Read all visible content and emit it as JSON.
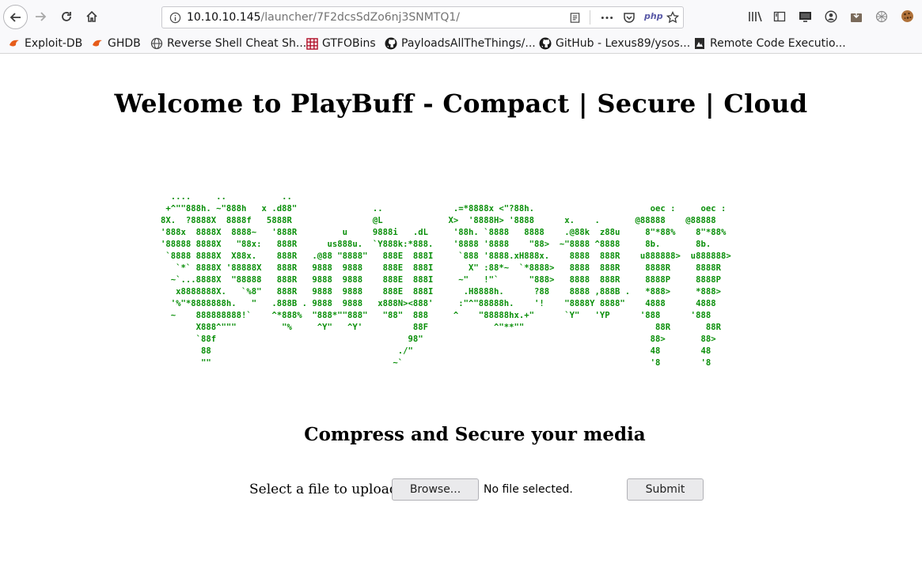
{
  "browser": {
    "url_host": "10.10.10.145",
    "url_path": "/launcher/7F2dcsSdZo6nj3SNMTQ1/",
    "php_label": "php",
    "toolbar_icons": [
      "back-icon",
      "forward-icon",
      "reload-icon",
      "home-icon",
      "info-icon",
      "reader-view-icon",
      "more-icon",
      "pocket-icon",
      "php-icon",
      "star-icon",
      "library-icon",
      "sidebar-icon",
      "screen-icon",
      "account-icon",
      "addon-icon",
      "extension-icon",
      "cookie-icon"
    ],
    "bookmarks": [
      {
        "label": "Exploit-DB",
        "icon": "exploit-db-icon"
      },
      {
        "label": "GHDB",
        "icon": "ghdb-icon"
      },
      {
        "label": "Reverse Shell Cheat Sh...",
        "icon": "globe-icon"
      },
      {
        "label": "GTFOBins",
        "icon": "gtfobins-icon"
      },
      {
        "label": "PayloadsAllTheThings/...",
        "icon": "github-icon"
      },
      {
        "label": "GitHub - Lexus89/ysos...",
        "icon": "github-icon"
      },
      {
        "label": "Remote Code Executio...",
        "icon": "page-icon"
      }
    ]
  },
  "page": {
    "title": "Welcome to PlayBuff - Compact | Secure | Cloud",
    "ascii_art": "  ....     ..           ..               \n +^\"\"888h. ~\"888h   x .d88\"               ..              .=*8888x <\"?88h.                       oec :     oec :\n8X.  ?8888X  8888f   5888R                @L             X>  '8888H> '8888      x.    .       @88888    @88888\n'888x  8888X  8888~   '888R         u     9888i   .dL     '88h. `8888   8888    .@88k  z88u     8\"*88%    8\"*88%\n'88888 8888X   \"88x:   888R      us888u.  `Y888k:*888.    '8888 '8888    \"88>  ~\"8888 ^8888     8b.       8b.\n `8888 8888X  X88x.    888R   .@88 \"8888\"   888E  888I     `888 '8888.xH888x.    8888  888R    u888888>  u888888>\n   `*` 8888X '88888X   888R   9888  9888    888E  888I       X\" :88*~  `*8888>   8888  888R     8888R     8888R\n  ~`...8888X  \"88888   888R   9888  9888    888E  888I     ~\"   !\"`      \"888>   8888  888R     8888P     8888P\n   x8888888X.   `%8\"   888R   9888  9888    888E  888I      .H8888h.      ?88    8888 ,888B .   *888>     *888>\n  '%\"*8888888h.   \"   .888B . 9888  9888   x888N><888'     :\"^\"88888h.    '!    \"8888Y 8888\"    4888      4888\n  ~    888888888!`    ^*888%  \"888*\"\"888\"   \"88\"  888     ^    \"88888hx.+\"      `Y\"   'YP      '888      '888\n       X888^\"\"\"         \"%     ^Y\"   ^Y'          88F             ^\"**\"\"                          88R       88R\n       `88f                                      98\"                                             88>       88>\n        88                                     ./\"                                               48        48\n        \"\"                                    ~`                                                 '8        '8",
    "subtitle": "Compress and Secure your media",
    "upload_label": "Select a file to upload",
    "browse_label": "Browse...",
    "no_file_text": "No file selected.",
    "submit_label": "Submit",
    "ascii_color": "#0a8f0a"
  }
}
